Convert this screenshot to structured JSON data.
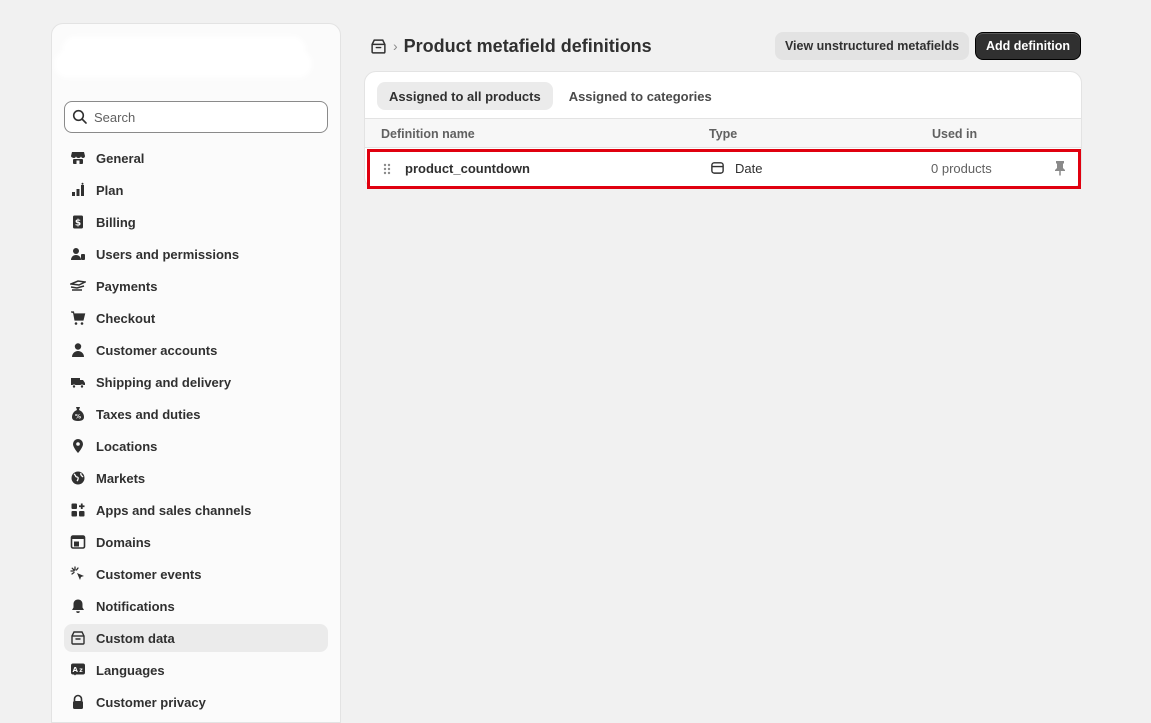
{
  "sidebar": {
    "search_placeholder": "Search",
    "items": [
      {
        "label": "General",
        "icon": "store-icon"
      },
      {
        "label": "Plan",
        "icon": "plan-icon"
      },
      {
        "label": "Billing",
        "icon": "billing-icon"
      },
      {
        "label": "Users and permissions",
        "icon": "users-icon"
      },
      {
        "label": "Payments",
        "icon": "payments-icon"
      },
      {
        "label": "Checkout",
        "icon": "cart-icon"
      },
      {
        "label": "Customer accounts",
        "icon": "person-icon"
      },
      {
        "label": "Shipping and delivery",
        "icon": "truck-icon"
      },
      {
        "label": "Taxes and duties",
        "icon": "tax-bag-icon"
      },
      {
        "label": "Locations",
        "icon": "location-pin-icon"
      },
      {
        "label": "Markets",
        "icon": "globe-icon"
      },
      {
        "label": "Apps and sales channels",
        "icon": "apps-icon"
      },
      {
        "label": "Domains",
        "icon": "domains-icon"
      },
      {
        "label": "Customer events",
        "icon": "cursor-click-icon"
      },
      {
        "label": "Notifications",
        "icon": "bell-icon"
      },
      {
        "label": "Custom data",
        "icon": "custom-data-icon",
        "active": true
      },
      {
        "label": "Languages",
        "icon": "language-icon"
      },
      {
        "label": "Customer privacy",
        "icon": "lock-icon"
      }
    ]
  },
  "header": {
    "breadcrumb_icon": "custom-data-icon",
    "breadcrumb_separator": "›",
    "title": "Product metafield definitions",
    "secondary_button": "View unstructured metafields",
    "primary_button": "Add definition"
  },
  "tabs": [
    {
      "label": "Assigned to all products",
      "active": true
    },
    {
      "label": "Assigned to categories",
      "active": false
    }
  ],
  "table": {
    "columns": [
      "Definition name",
      "Type",
      "Used in"
    ],
    "rows": [
      {
        "name": "product_countdown",
        "type": "Date",
        "used_in": "0 products"
      }
    ]
  },
  "colors": {
    "highlight": "#e0000f",
    "primary_button": "#303030",
    "background": "#f1f1f1"
  }
}
